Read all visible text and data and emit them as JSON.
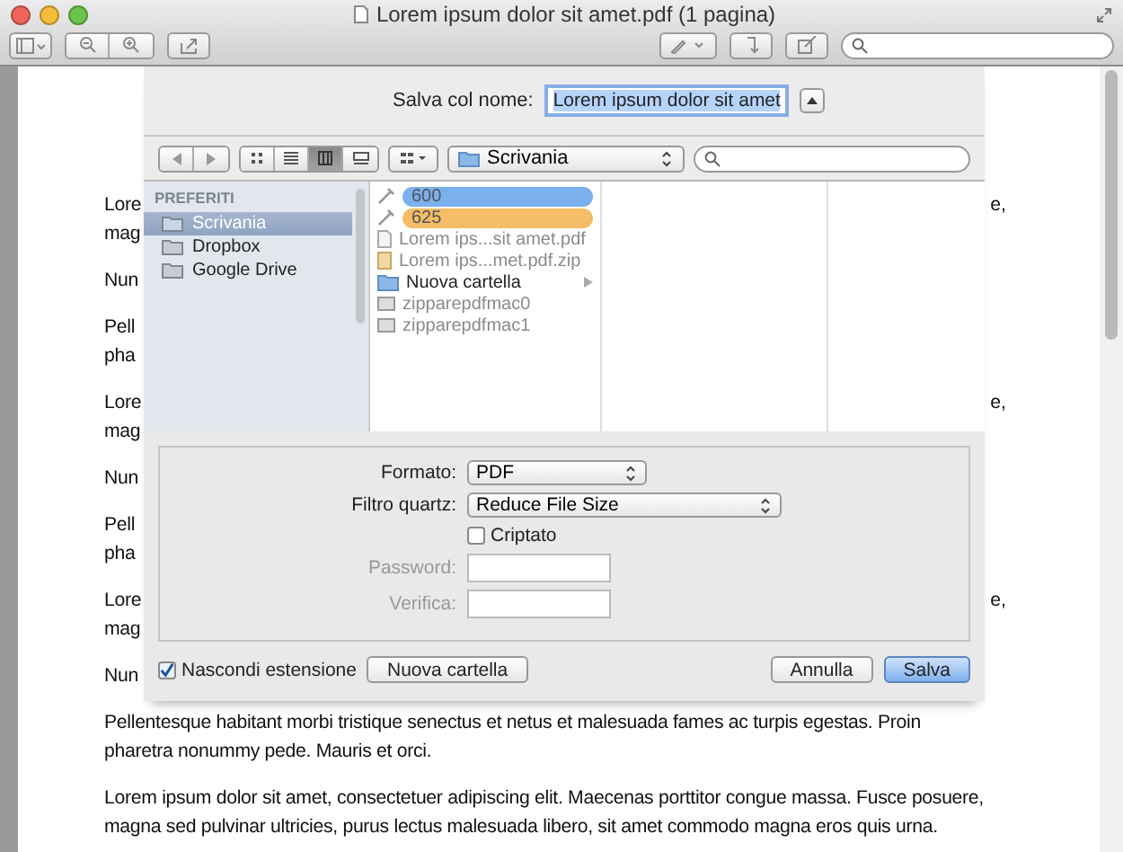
{
  "window": {
    "title": "Lorem ipsum dolor sit amet.pdf (1 pagina)"
  },
  "document": {
    "paragraphs": [
      {
        "lines": [
          {
            "text": "Lore",
            "tail": "e,"
          },
          {
            "text": "mag"
          }
        ]
      },
      {
        "lines": [
          {
            "text": "Nun"
          }
        ]
      },
      {
        "lines": [
          {
            "text": "Pell"
          },
          {
            "text": "pha"
          }
        ]
      },
      {
        "lines": [
          {
            "text": "Lore",
            "tail": "e,"
          },
          {
            "text": "mag"
          }
        ]
      },
      {
        "lines": [
          {
            "text": "Nun"
          }
        ]
      },
      {
        "lines": [
          {
            "text": "Pell"
          },
          {
            "text": "pha"
          }
        ]
      },
      {
        "lines": [
          {
            "text": "Lore",
            "tail": "e,"
          },
          {
            "text": "mag"
          }
        ]
      },
      {
        "lines": [
          {
            "text": "Nun"
          }
        ]
      },
      {
        "lines": [
          {
            "text": "Pellentesque habitant morbi tristique senectus et netus et malesuada fames ac turpis egestas. Proin"
          },
          {
            "text": "pharetra nonummy pede. Mauris et orci."
          }
        ]
      },
      {
        "lines": [
          {
            "text": "Lorem ipsum dolor sit amet, consectetuer adipiscing elit. Maecenas porttitor congue massa. Fusce posuere,"
          },
          {
            "text": "magna sed pulvinar ultricies, purus lectus malesuada libero, sit amet commodo magna eros quis urna."
          }
        ]
      }
    ]
  },
  "save_sheet": {
    "name_label": "Salva col nome:",
    "name_value": "Lorem ipsum dolor sit amet",
    "view_modes": [
      {
        "selected": false
      },
      {
        "selected": false
      },
      {
        "selected": true
      },
      {
        "selected": false
      }
    ],
    "location": "Scrivania",
    "sidebar": {
      "header": "PREFERITI",
      "items": [
        {
          "label": "Scrivania",
          "selected": true
        },
        {
          "label": "Dropbox",
          "selected": false
        },
        {
          "label": "Google Drive",
          "selected": false
        }
      ]
    },
    "files": [
      {
        "name": "600",
        "kind": "tag",
        "color": "#7ab0ee",
        "disabled": false
      },
      {
        "name": "625",
        "kind": "tag",
        "color": "#f4bd66",
        "disabled": false
      },
      {
        "name": "Lorem ips...sit amet.pdf",
        "kind": "pdf",
        "disabled": true
      },
      {
        "name": "Lorem ips...met.pdf.zip",
        "kind": "zip",
        "disabled": true
      },
      {
        "name": "Nuova cartella",
        "kind": "folder",
        "disabled": false
      },
      {
        "name": "zipparepdfmac0",
        "kind": "image",
        "disabled": true
      },
      {
        "name": "zipparepdfmac1",
        "kind": "image",
        "disabled": true
      }
    ],
    "options": {
      "format": {
        "label": "Formato:",
        "value": "PDF"
      },
      "quartz_filter": {
        "label": "Filtro quartz:",
        "value": "Reduce File Size"
      },
      "encrypt": {
        "label": "Criptato",
        "checked": false
      },
      "password": {
        "label": "Password:",
        "disabled": true
      },
      "verify": {
        "label": "Verifica:",
        "disabled": true
      }
    },
    "hide_extension": {
      "label": "Nascondi estensione",
      "checked": true
    },
    "new_folder_button": "Nuova cartella",
    "buttons": [
      {
        "label": "Annulla",
        "kind": "normal"
      },
      {
        "label": "Salva",
        "kind": "default"
      }
    ]
  }
}
